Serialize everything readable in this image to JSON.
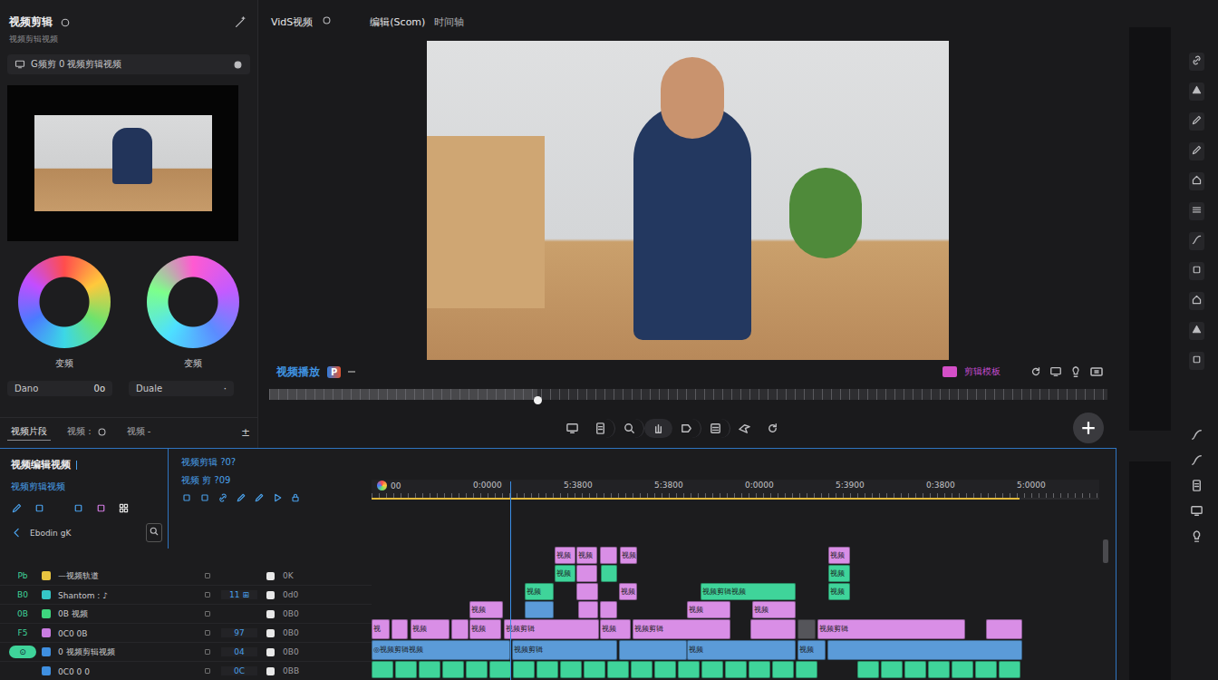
{
  "media_panel": {
    "title": "视频剪辑",
    "subtitle": "视频剪辑视频",
    "source": "G频剪 0 视频剪辑视频",
    "wheels": [
      {
        "label": "变频"
      },
      {
        "label": "变频"
      }
    ],
    "fields": [
      {
        "label": "Dano",
        "value": "0o"
      },
      {
        "label": "Duale",
        "value": "·"
      }
    ],
    "tabs": [
      {
        "label": "视频片段",
        "selected": true
      },
      {
        "label": "视频 :",
        "selected": false
      },
      {
        "label": "视频 -",
        "selected": false
      }
    ],
    "tab_icon": "±"
  },
  "viewer": {
    "title": "VidS视频",
    "tabs": [
      {
        "label": "编辑(Scom)",
        "selected": true
      },
      {
        "label": "时间轴",
        "selected": false
      }
    ],
    "clip_label": "视频播放",
    "badge": "P",
    "right_label": "剪辑模板",
    "scrubber": {
      "level": 0.32
    }
  },
  "timeline": {
    "title": "视频编辑视频",
    "subtitle": "视频剪辑视频",
    "search": {
      "value": "Ebodin gK"
    },
    "controls_title": "视频剪辑 ?0?",
    "controls_sub": "视频 剪 ?09",
    "ruler": [
      "00",
      "0:0000",
      "5:3800",
      "5:3800",
      "0:0000",
      "5:3900",
      "0:3800",
      "5:0000"
    ],
    "playhead": {
      "level": 0.19
    },
    "work_area": {
      "level": 0.89
    },
    "headers": [
      {
        "code": "Pb",
        "name": "—视频轨道",
        "value": "0K",
        "color": "#e8c440",
        "selected": false
      },
      {
        "code": "B0",
        "name": "Shantom : ♪",
        "mid": "11 ⊞",
        "value": "0d0",
        "color": "#35c6c8",
        "selected": false
      },
      {
        "code": "0B",
        "name": "0B 视频",
        "value": "0B0",
        "color": "#3ed67e",
        "selected": false
      },
      {
        "code": "F5",
        "name": "0C0 0B",
        "mid": "97",
        "value": "0B0",
        "color": "#c97be0",
        "selected": false
      },
      {
        "code": "⊙",
        "name": "0 视频剪辑视频",
        "mid": "04",
        "value": "0B0",
        "color": "#3f8fe0",
        "selected": true
      },
      {
        "name": "0C0 0 0",
        "mid": "0C",
        "value": "0BB",
        "color": "#3f8fe0",
        "selected": false
      }
    ],
    "tracks": [
      {
        "clips": [
          {
            "start": 202,
            "end": 225,
            "color": "#d98ee6",
            "label": "视频"
          },
          {
            "start": 226,
            "end": 249,
            "color": "#d98ee6",
            "label": "视频"
          },
          {
            "start": 252,
            "end": 271,
            "color": "#d98ee6"
          },
          {
            "start": 274,
            "end": 293,
            "color": "#d98ee6",
            "label": "视频"
          },
          {
            "start": 504,
            "end": 528,
            "color": "#d98ee6",
            "label": "视频"
          }
        ]
      },
      {
        "clips": [
          {
            "start": 202,
            "end": 225,
            "color": "#3fd49a",
            "label": "视频"
          },
          {
            "start": 226,
            "end": 249,
            "color": "#d98ee6"
          },
          {
            "start": 253,
            "end": 271,
            "color": "#3fd49a"
          },
          {
            "start": 504,
            "end": 528,
            "color": "#3fd49a",
            "label": "视频"
          }
        ]
      },
      {
        "clips": [
          {
            "start": 169,
            "end": 201,
            "color": "#3fd49a",
            "label": "视频"
          },
          {
            "start": 226,
            "end": 250,
            "color": "#d98ee6"
          },
          {
            "start": 273,
            "end": 293,
            "color": "#d98ee6",
            "label": "视频"
          },
          {
            "start": 363,
            "end": 468,
            "color": "#3fd49a",
            "label": "视频剪辑视频"
          },
          {
            "start": 504,
            "end": 528,
            "color": "#3fd49a",
            "label": "视频"
          }
        ]
      },
      {
        "clips": [
          {
            "start": 108,
            "end": 145,
            "color": "#d98ee6",
            "label": "视频"
          },
          {
            "start": 169,
            "end": 201,
            "color": "#5b9bd8"
          },
          {
            "start": 228,
            "end": 250,
            "color": "#d98ee6"
          },
          {
            "start": 252,
            "end": 271,
            "color": "#d98ee6"
          },
          {
            "start": 348,
            "end": 396,
            "color": "#d98ee6",
            "label": "视频"
          },
          {
            "start": 420,
            "end": 468,
            "color": "#d98ee6",
            "label": "视频"
          }
        ]
      },
      {
        "clips": [
          {
            "start": 0,
            "end": 20,
            "color": "#d98ee6",
            "label": "视"
          },
          {
            "start": 22,
            "end": 40,
            "color": "#d98ee6"
          },
          {
            "start": 43,
            "end": 86,
            "color": "#d98ee6",
            "label": "视频"
          },
          {
            "start": 88,
            "end": 107,
            "color": "#d98ee6"
          },
          {
            "start": 108,
            "end": 143,
            "color": "#d98ee6",
            "label": "视频"
          },
          {
            "start": 146,
            "end": 251,
            "color": "#d98ee6",
            "label": "视频剪辑"
          },
          {
            "start": 252,
            "end": 286,
            "color": "#d98ee6",
            "label": "视频"
          },
          {
            "start": 288,
            "end": 396,
            "color": "#d98ee6",
            "label": "视频剪辑"
          },
          {
            "start": 418,
            "end": 468,
            "color": "#d98ee6"
          },
          {
            "start": 470,
            "end": 490,
            "color": "#55555a"
          },
          {
            "start": 492,
            "end": 655,
            "color": "#d98ee6",
            "label": "视频剪辑"
          },
          {
            "start": 678,
            "end": 718,
            "color": "#d98ee6"
          }
        ]
      },
      {
        "clips": [
          {
            "start": 0,
            "end": 153,
            "color": "#5b9bd8",
            "label": "◎视频剪辑视频"
          },
          {
            "start": 155,
            "end": 271,
            "color": "#5b9bd8",
            "label": "视频剪辑"
          },
          {
            "start": 273,
            "end": 348,
            "color": "#5b9bd8"
          },
          {
            "start": 348,
            "end": 468,
            "color": "#5b9bd8",
            "label": "视频"
          },
          {
            "start": 470,
            "end": 501,
            "color": "#5b9bd8",
            "label": "视频"
          },
          {
            "start": 503,
            "end": 718,
            "color": "#5b9bd8"
          }
        ]
      },
      {
        "clips": [
          {
            "start": 0,
            "end": 24,
            "color": "#3fd49a"
          },
          {
            "start": 26,
            "end": 50,
            "color": "#3fd49a"
          },
          {
            "start": 52,
            "end": 76,
            "color": "#3fd49a"
          },
          {
            "start": 78,
            "end": 102,
            "color": "#3fd49a"
          },
          {
            "start": 104,
            "end": 128,
            "color": "#3fd49a"
          },
          {
            "start": 130,
            "end": 154,
            "color": "#3fd49a"
          },
          {
            "start": 156,
            "end": 180,
            "color": "#3fd49a"
          },
          {
            "start": 182,
            "end": 206,
            "color": "#3fd49a"
          },
          {
            "start": 208,
            "end": 232,
            "color": "#3fd49a"
          },
          {
            "start": 234,
            "end": 258,
            "color": "#3fd49a"
          },
          {
            "start": 260,
            "end": 284,
            "color": "#3fd49a"
          },
          {
            "start": 286,
            "end": 310,
            "color": "#3fd49a"
          },
          {
            "start": 312,
            "end": 336,
            "color": "#3fd49a"
          },
          {
            "start": 338,
            "end": 362,
            "color": "#3fd49a"
          },
          {
            "start": 364,
            "end": 388,
            "color": "#3fd49a"
          },
          {
            "start": 390,
            "end": 414,
            "color": "#3fd49a"
          },
          {
            "start": 416,
            "end": 440,
            "color": "#3fd49a"
          },
          {
            "start": 442,
            "end": 466,
            "color": "#3fd49a"
          },
          {
            "start": 468,
            "end": 492,
            "color": "#3fd49a"
          },
          {
            "start": 536,
            "end": 560,
            "color": "#3fd49a"
          },
          {
            "start": 562,
            "end": 586,
            "color": "#3fd49a"
          },
          {
            "start": 588,
            "end": 612,
            "color": "#3fd49a"
          },
          {
            "start": 614,
            "end": 638,
            "color": "#3fd49a"
          },
          {
            "start": 640,
            "end": 664,
            "color": "#3fd49a"
          },
          {
            "start": 666,
            "end": 690,
            "color": "#3fd49a"
          },
          {
            "start": 692,
            "end": 716,
            "color": "#3fd49a"
          }
        ]
      }
    ]
  }
}
